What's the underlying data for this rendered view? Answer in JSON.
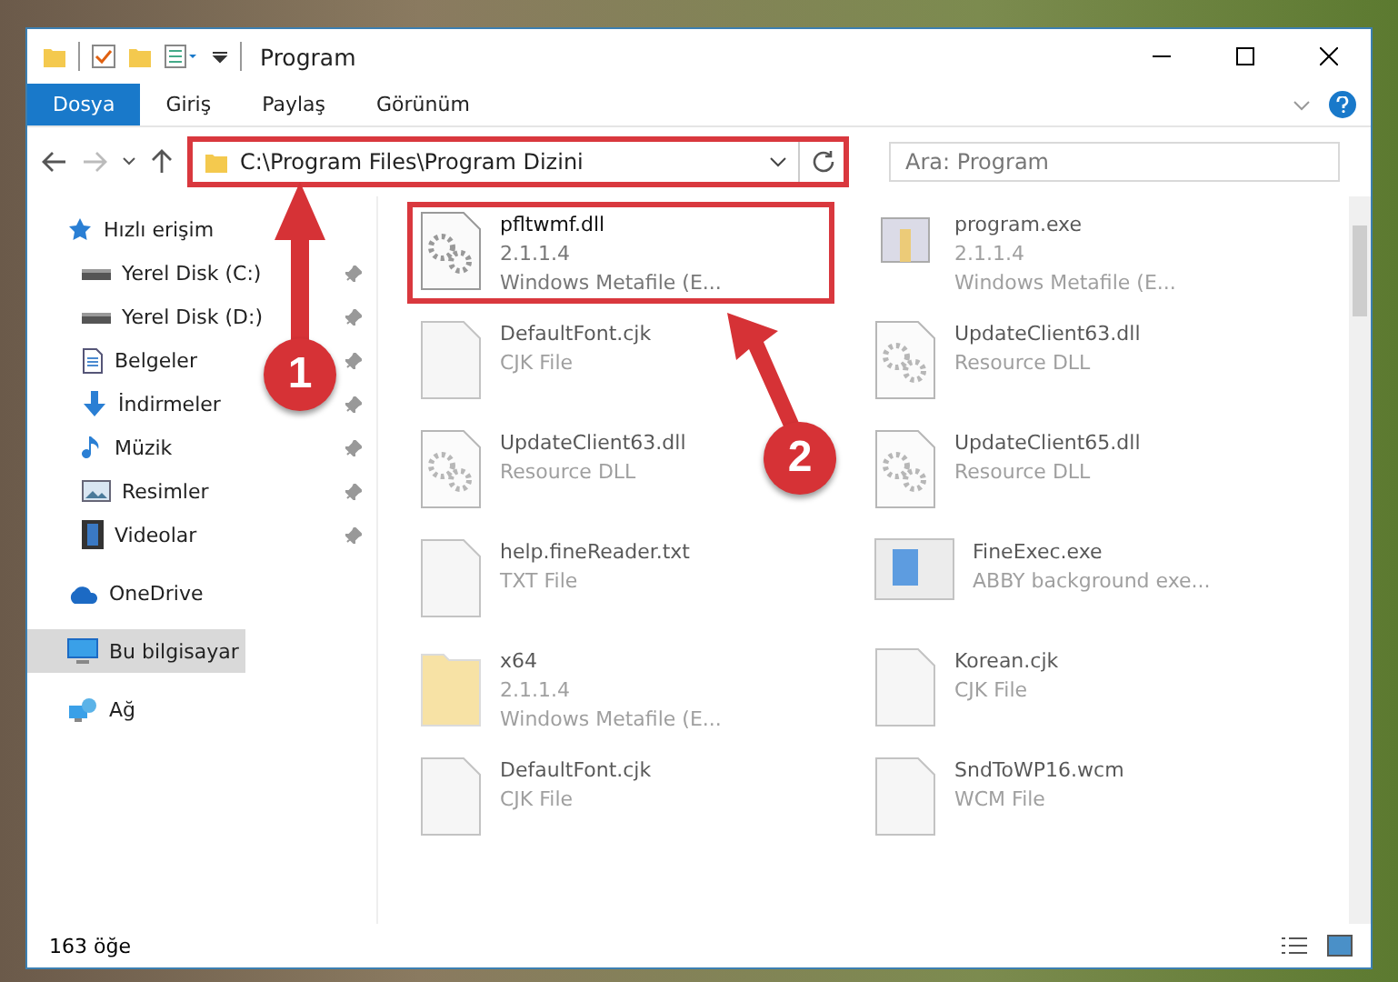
{
  "window": {
    "title": "Program"
  },
  "ribbon_tabs": [
    {
      "label": "Dosya",
      "selected": true
    },
    {
      "label": "Giriş",
      "selected": false
    },
    {
      "label": "Paylaş",
      "selected": false
    },
    {
      "label": "Görünüm",
      "selected": false
    }
  ],
  "address_bar": {
    "path": "C:\\Program Files\\Program Dizini",
    "highlighted": true
  },
  "search": {
    "placeholder": "Ara: Program"
  },
  "sidebar": {
    "items": [
      {
        "label": "Hızlı erişim",
        "kind": "quick",
        "selected": false,
        "pinned": false,
        "children": [
          {
            "label": "Yerel Disk (C:)",
            "kind": "disk",
            "selected": false,
            "pinned": true
          },
          {
            "label": "Yerel Disk (D:)",
            "kind": "disk",
            "selected": false,
            "pinned": true
          },
          {
            "label": "Belgeler",
            "kind": "docs",
            "selected": false,
            "pinned": true
          },
          {
            "label": "İndirmeler",
            "kind": "downloads",
            "selected": false,
            "pinned": true
          },
          {
            "label": "Müzik",
            "kind": "music",
            "selected": false,
            "pinned": true
          },
          {
            "label": "Resimler",
            "kind": "pictures",
            "selected": false,
            "pinned": true
          },
          {
            "label": "Videolar",
            "kind": "videos",
            "selected": false,
            "pinned": true
          }
        ]
      },
      {
        "label": "OneDrive",
        "kind": "cloud",
        "selected": false,
        "pinned": false
      },
      {
        "label": "Bu bilgisayar",
        "kind": "pc",
        "selected": true,
        "pinned": false
      },
      {
        "label": "Ağ",
        "kind": "network",
        "selected": false,
        "pinned": false
      }
    ]
  },
  "files": [
    {
      "name": "pfltwmf.dll",
      "kind": "dll",
      "details": [
        "2.1.1.4",
        "Windows Metafile (E..."
      ],
      "highlighted": true
    },
    {
      "name": "program.exe",
      "kind": "app",
      "details": [
        "2.1.1.4",
        "Windows Metafile (E..."
      ],
      "highlighted": false
    },
    {
      "name": "DefaultFont.cjk",
      "kind": "doc",
      "details": [
        "CJK File"
      ],
      "highlighted": false
    },
    {
      "name": "UpdateClient63.dll",
      "kind": "dll",
      "details": [
        "Resource DLL"
      ],
      "highlighted": false
    },
    {
      "name": "UpdateClient63.dll",
      "kind": "dll",
      "details": [
        "Resource DLL"
      ],
      "highlighted": false
    },
    {
      "name": "UpdateClient65.dll",
      "kind": "dll",
      "details": [
        "Resource DLL"
      ],
      "highlighted": false
    },
    {
      "name": "help.fineReader.txt",
      "kind": "doc",
      "details": [
        "TXT File"
      ],
      "highlighted": false
    },
    {
      "name": "FineExec.exe",
      "kind": "exe",
      "details": [
        "ABBY background exe..."
      ],
      "highlighted": false
    },
    {
      "name": "x64",
      "kind": "folder",
      "details": [
        "2.1.1.4",
        "Windows Metafile (E..."
      ],
      "highlighted": false
    },
    {
      "name": "Korean.cjk",
      "kind": "doc",
      "details": [
        "CJK File"
      ],
      "highlighted": false
    },
    {
      "name": "DefaultFont.cjk",
      "kind": "doc",
      "details": [
        "CJK File"
      ],
      "highlighted": false
    },
    {
      "name": "SndToWP16.wcm",
      "kind": "doc",
      "details": [
        "WCM File"
      ],
      "highlighted": false
    }
  ],
  "status_bar": {
    "count": "163 öğe"
  },
  "callouts": [
    {
      "number": "1"
    },
    {
      "number": "2"
    }
  ]
}
